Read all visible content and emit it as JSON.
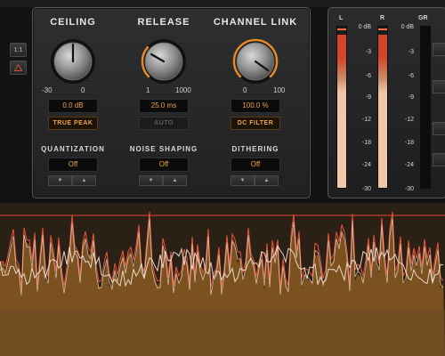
{
  "side_buttons": [
    {
      "label": "1:1",
      "icon": "ratio"
    },
    {
      "label": "",
      "icon": "warning-triangle-icon"
    }
  ],
  "ceiling": {
    "title": "CEILING",
    "min": "-30",
    "max": "0",
    "value": "0.0 dB",
    "mode_label": "TRUE PEAK",
    "mode_active": true,
    "knob_fraction": 1.0
  },
  "release": {
    "title": "RELEASE",
    "min": "1",
    "max": "1000",
    "value": "25.0 ms",
    "mode_label": "AUTO",
    "mode_active": false,
    "knob_fraction": 0.32
  },
  "channel_link": {
    "title": "CHANNEL LINK",
    "min": "0",
    "max": "100",
    "value": "100.0 %",
    "mode_label": "DC FILTER",
    "mode_active": true,
    "knob_fraction": 1.0
  },
  "quantization": {
    "title": "QUANTIZATION",
    "value": "Off"
  },
  "noise_shaping": {
    "title": "NOISE SHAPING",
    "value": "Off"
  },
  "dithering": {
    "title": "DITHERING",
    "value": "Off"
  },
  "meters": {
    "labels": {
      "left": "L",
      "right": "R",
      "gr": "GR"
    },
    "scale": [
      "0 dB",
      "-3",
      "-6",
      "-9",
      "-12",
      "-18",
      "-24",
      "-30"
    ],
    "gr_scale": [
      "0 dB",
      "-3",
      "-6",
      "-9",
      "-12",
      "-18",
      "-24",
      "-30"
    ],
    "left_level": 0.95,
    "right_level": 0.95,
    "gr_level": 0.0
  },
  "colors": {
    "accent": "#f0a24a",
    "meter_fill": "#f2c7a8",
    "meter_hot": "#d4442a",
    "waveform_fill": "#8a5a22",
    "waveform_peak": "#e8563a",
    "waveform_line": "#f4e8d6"
  }
}
